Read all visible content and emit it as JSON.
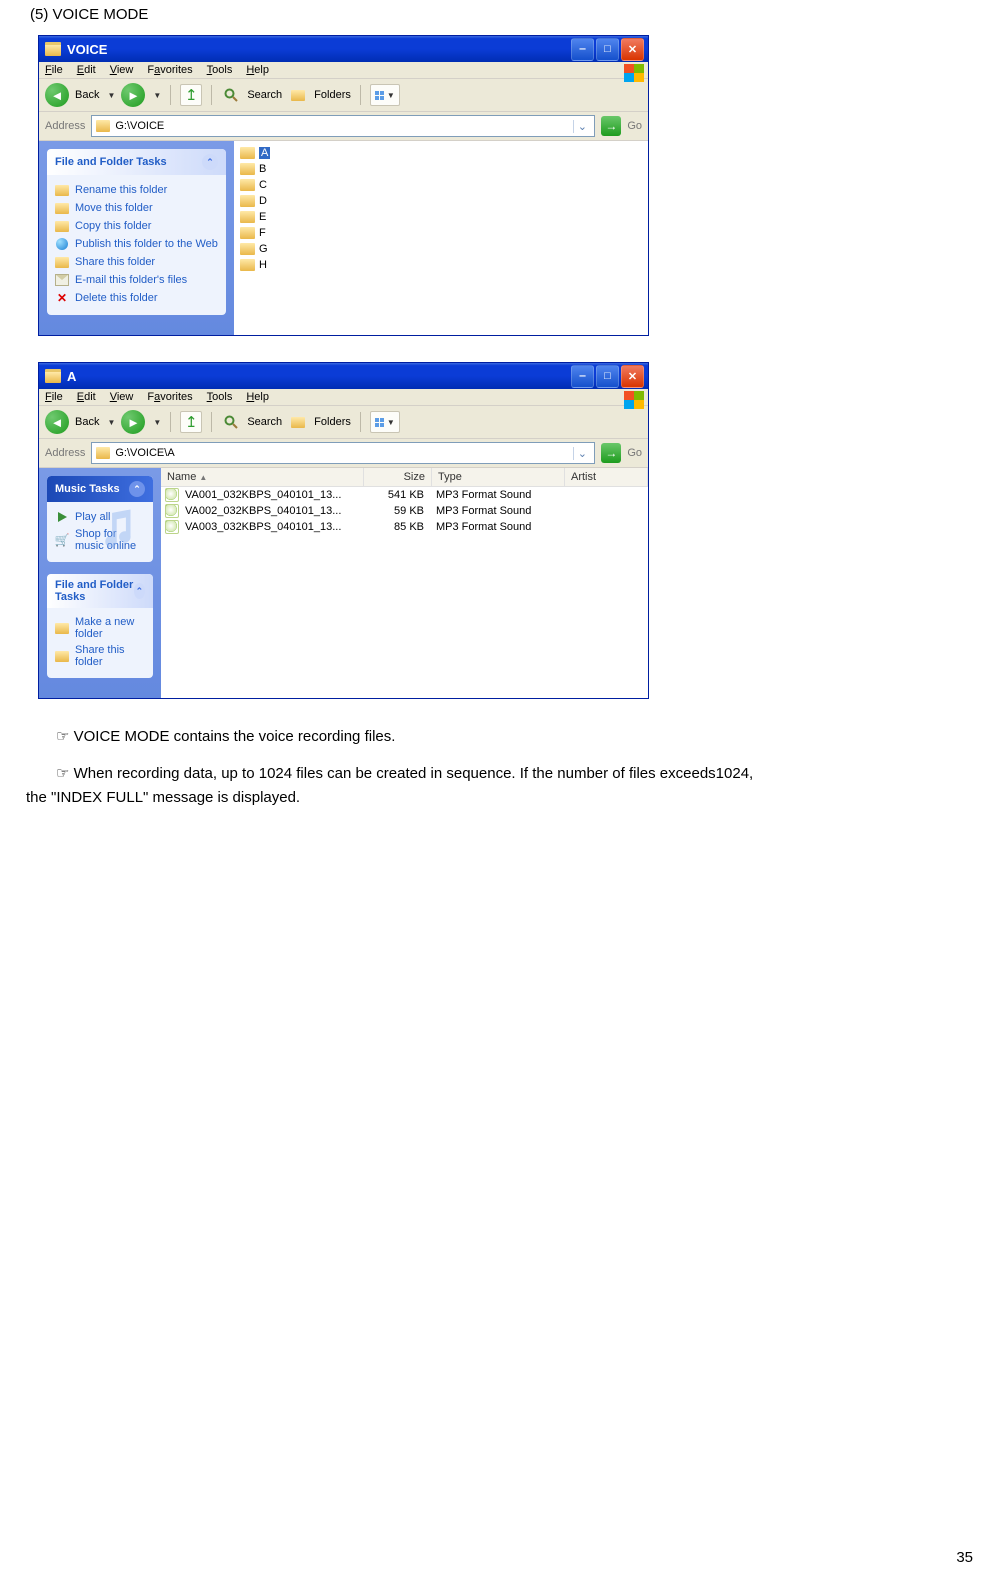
{
  "heading": "(5)  VOICE MODE",
  "window1": {
    "title": "VOICE",
    "menus": [
      "File",
      "Edit",
      "View",
      "Favorites",
      "Tools",
      "Help"
    ],
    "toolbar": {
      "back": "Back",
      "search": "Search",
      "folders": "Folders"
    },
    "address_label": "Address",
    "address_value": "G:\\VOICE",
    "go_label": "Go",
    "tasks_title": "File and Folder Tasks",
    "tasks": [
      "Rename this folder",
      "Move this folder",
      "Copy this folder",
      "Publish this folder to the Web",
      "Share this folder",
      "E-mail this folder's files",
      "Delete this folder"
    ],
    "folders": [
      "A",
      "B",
      "C",
      "D",
      "E",
      "F",
      "G",
      "H"
    ]
  },
  "window2": {
    "title": "A",
    "menus": [
      "File",
      "Edit",
      "View",
      "Favorites",
      "Tools",
      "Help"
    ],
    "toolbar": {
      "back": "Back",
      "search": "Search",
      "folders": "Folders"
    },
    "address_label": "Address",
    "address_value": "G:\\VOICE\\A",
    "go_label": "Go",
    "music_title": "Music Tasks",
    "music_tasks": [
      "Play all",
      "Shop for music online"
    ],
    "tasks_title": "File and Folder Tasks",
    "tasks": [
      "Make a new folder",
      "Share this folder"
    ],
    "columns": [
      "Name",
      "Size",
      "Type",
      "Artist"
    ],
    "files": [
      {
        "name": "VA001_032KBPS_040101_13...",
        "size": "541 KB",
        "type": "MP3 Format Sound"
      },
      {
        "name": "VA002_032KBPS_040101_13...",
        "size": "59 KB",
        "type": "MP3 Format Sound"
      },
      {
        "name": "VA003_032KBPS_040101_13...",
        "size": "85 KB",
        "type": "MP3 Format Sound"
      }
    ]
  },
  "para1": "☞ VOICE MODE contains the voice recording files.",
  "para2": "☞ When recording data, up to 1024 files can be created in sequence. If the number of files exceeds1024, the \"INDEX FULL\" message is displayed.",
  "page_number": "35"
}
